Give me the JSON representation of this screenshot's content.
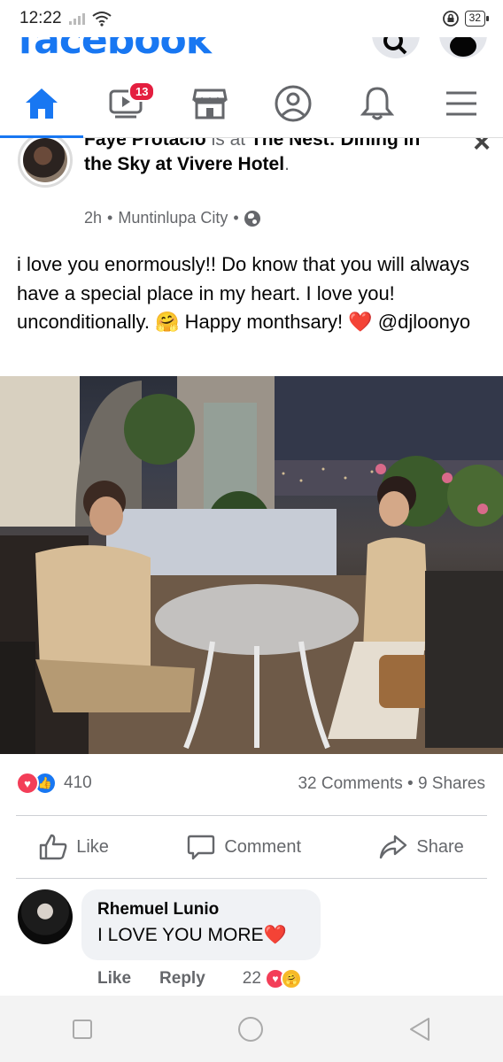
{
  "status": {
    "time": "12:22",
    "battery": "32",
    "icons": [
      "signal-icon",
      "wifi-icon",
      "rotation-lock-icon",
      "battery-icon"
    ]
  },
  "header": {
    "logo": "facebook",
    "icons": [
      "search-icon",
      "messenger-icon"
    ]
  },
  "nav": {
    "tabs": [
      {
        "name": "home",
        "icon": "home-icon",
        "active": true
      },
      {
        "name": "watch",
        "icon": "video-icon",
        "badge": "13"
      },
      {
        "name": "marketplace",
        "icon": "store-icon"
      },
      {
        "name": "profile",
        "icon": "profile-icon"
      },
      {
        "name": "notifications",
        "icon": "bell-icon"
      },
      {
        "name": "menu",
        "icon": "hamburger-icon"
      }
    ],
    "watch_badge": "13"
  },
  "post": {
    "author": "Faye Protacio",
    "is_at": "is at",
    "place": "The Nest: Dining in the Sky at Vivere Hotel",
    "period": ".",
    "time": "2h",
    "location": "Muntinlupa City",
    "dot": "•",
    "text": "i love you enormously!! Do know that you will always have a special place in my heart. I love you! unconditionally. 🤗 Happy monthsary! ❤️ @djloonyo",
    "reaction_count": "410",
    "comments": "32 Comments",
    "shares": "9 Shares",
    "accent": "#1877f2",
    "love_color": "#f33e58"
  },
  "actions": {
    "like": "Like",
    "comment": "Comment",
    "share": "Share"
  },
  "comment": {
    "author": "Rhemuel Lunio",
    "text": "I LOVE YOU MORE❤️",
    "like": "Like",
    "reply": "Reply",
    "reaction_count": "22"
  }
}
